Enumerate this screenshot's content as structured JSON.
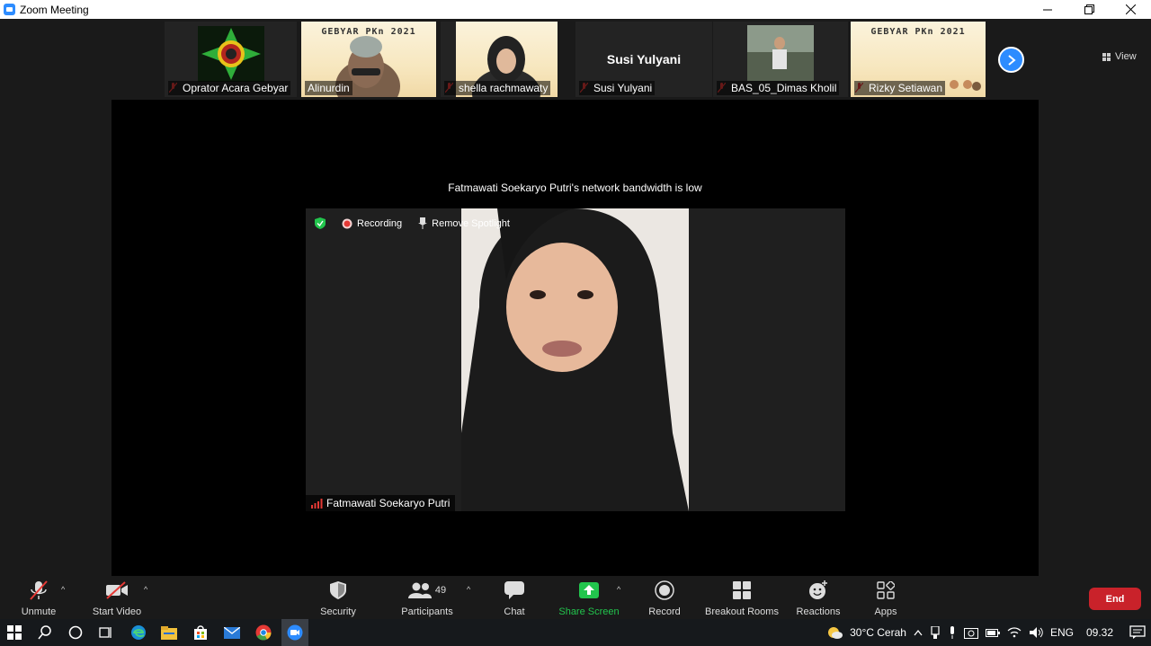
{
  "window": {
    "title": "Zoom Meeting"
  },
  "gallery": {
    "tiles": [
      {
        "name": "Oprator Acara Gebyar",
        "muted": true
      },
      {
        "name": "Alinurdin",
        "muted": false
      },
      {
        "name": "shella rachmawaty",
        "muted": true
      },
      {
        "name": "Susi Yulyani",
        "muted": true,
        "big_name": "Susi Yulyani"
      },
      {
        "name": "BAS_05_Dimas Kholil",
        "muted": true
      },
      {
        "name": "Rizky Setiawan",
        "muted": true
      }
    ],
    "poster_title": "GEBYAR PKn 2021",
    "view_label": "View"
  },
  "stage": {
    "bandwidth_notice": "Fatmawati Soekaryo Putri's network bandwidth is low",
    "recording_label": "Recording",
    "remove_spotlight_label": "Remove Spotlight",
    "speaker_name": "Fatmawati Soekaryo Putri"
  },
  "toolbar": {
    "unmute": "Unmute",
    "start_video": "Start Video",
    "security": "Security",
    "participants": "Participants",
    "participants_count": "49",
    "chat": "Chat",
    "share_screen": "Share Screen",
    "record": "Record",
    "breakout_rooms": "Breakout Rooms",
    "reactions": "Reactions",
    "apps": "Apps",
    "end": "End"
  },
  "taskbar": {
    "weather": "30°C  Cerah",
    "language": "ENG",
    "time": "09.32"
  },
  "colors": {
    "accent": "#2d8cff",
    "end": "#c9222a",
    "share": "#22c54d",
    "mute": "#e53935"
  }
}
